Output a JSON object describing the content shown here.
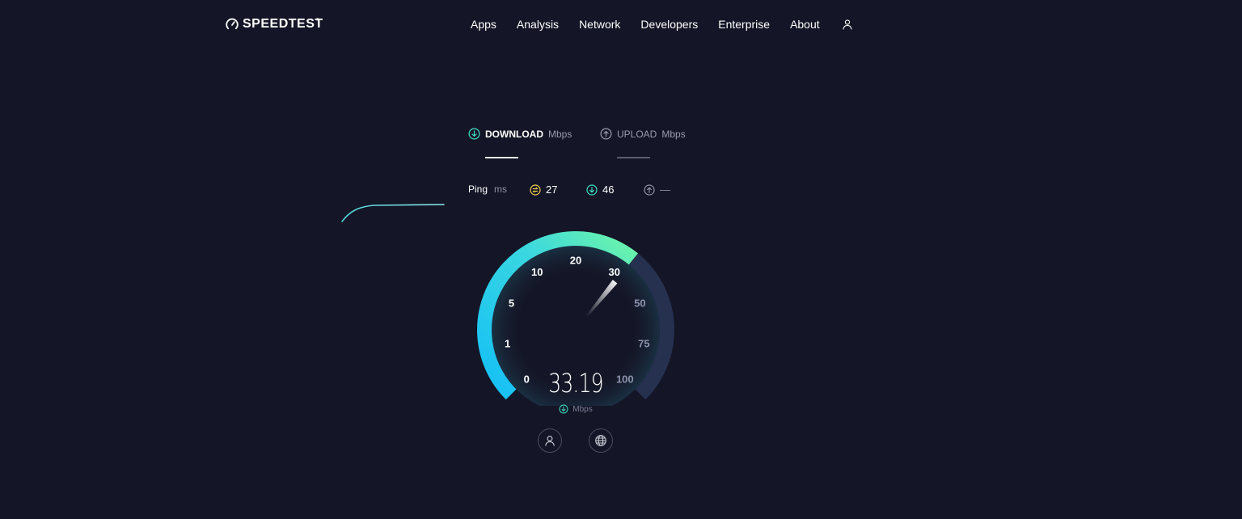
{
  "brand": {
    "name": "SPEEDTEST",
    "tm": "®"
  },
  "nav": {
    "items": [
      "Apps",
      "Analysis",
      "Network",
      "Developers",
      "Enterprise",
      "About"
    ]
  },
  "tabs": {
    "download": {
      "label": "DOWNLOAD",
      "unit": "Mbps"
    },
    "upload": {
      "label": "UPLOAD",
      "unit": "Mbps"
    }
  },
  "ping": {
    "label": "Ping",
    "unit": "ms",
    "idle": "27",
    "download": "46",
    "upload": "—"
  },
  "gauge": {
    "ticks": [
      "0",
      "1",
      "5",
      "10",
      "20",
      "30",
      "50",
      "75",
      "100"
    ],
    "value": "33.19",
    "unit": "Mbps",
    "active_color_start": "#1bc8f5",
    "active_color_end": "#6ef5a8",
    "inactive_color": "#263150"
  },
  "colors": {
    "background": "#141526",
    "accent": "#3fe0c7",
    "ping_icon": "#f5d04b"
  },
  "icons": {
    "logo": "speedometer-icon",
    "user": "user-icon",
    "download": "arrow-down-circle-icon",
    "upload": "arrow-up-circle-icon",
    "ping": "ping-icon",
    "globe": "globe-icon"
  }
}
